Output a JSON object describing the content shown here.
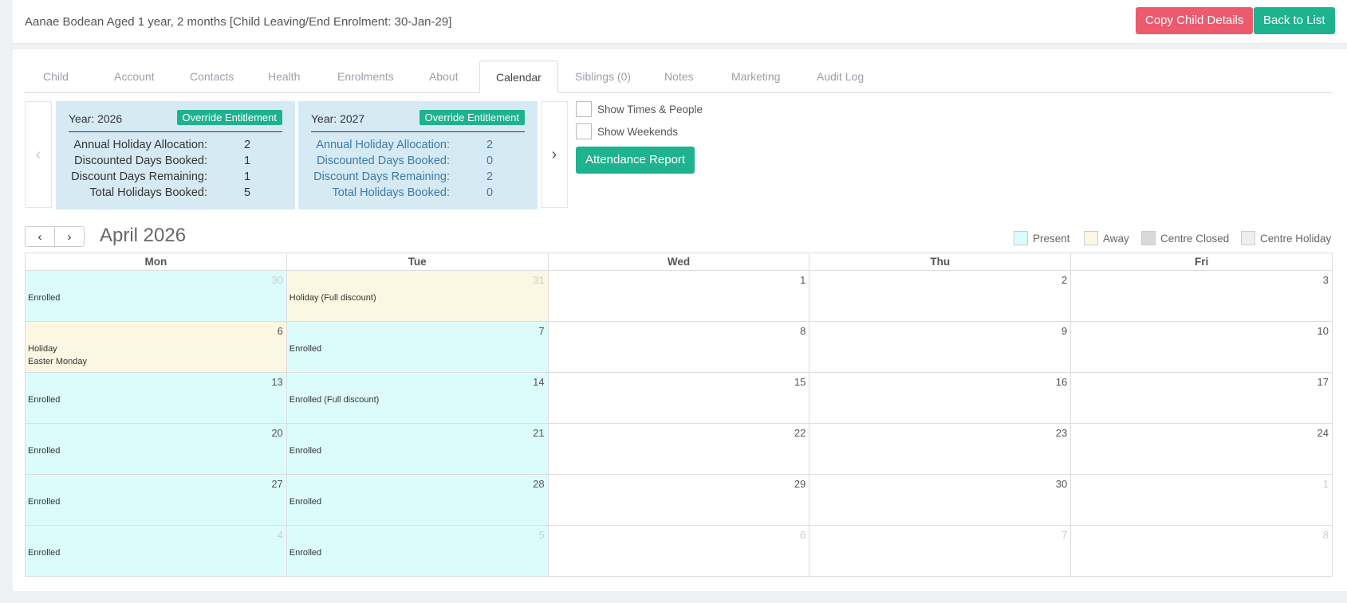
{
  "header": {
    "title": "Aanae Bodean Aged 1 year, 2 months [Child Leaving/End Enrolment: 30-Jan-29]",
    "copy_label": "Copy Child Details",
    "back_label": "Back to List"
  },
  "tabs": [
    {
      "label": "Child"
    },
    {
      "label": "Account"
    },
    {
      "label": "Contacts"
    },
    {
      "label": "Health"
    },
    {
      "label": "Enrolments"
    },
    {
      "label": "About"
    },
    {
      "label": "Calendar"
    },
    {
      "label": "Siblings (0)"
    },
    {
      "label": "Notes"
    },
    {
      "label": "Marketing"
    },
    {
      "label": "Audit Log"
    }
  ],
  "entitlements": [
    {
      "year_label": "Year: 2026",
      "override_label": "Override Entitlement",
      "stats": [
        {
          "label": "Annual Holiday Allocation:",
          "value": "2"
        },
        {
          "label": "Discounted Days Booked:",
          "value": "1"
        },
        {
          "label": "Discount Days Remaining:",
          "value": "1"
        },
        {
          "label": "Total Holidays Booked:",
          "value": "5"
        }
      ]
    },
    {
      "year_label": "Year: 2027",
      "override_label": "Override Entitlement",
      "stats": [
        {
          "label": "Annual Holiday Allocation:",
          "value": "2"
        },
        {
          "label": "Discounted Days Booked:",
          "value": "0"
        },
        {
          "label": "Discount Days Remaining:",
          "value": "2"
        },
        {
          "label": "Total Holidays Booked:",
          "value": "0"
        }
      ]
    }
  ],
  "options": {
    "show_times": "Show Times & People",
    "show_weekends": "Show Weekends",
    "attendance_report": "Attendance Report"
  },
  "calendar": {
    "title": "April 2026",
    "legend": [
      {
        "label": "Present",
        "color": "#dcfcfc"
      },
      {
        "label": "Away",
        "color": "#fcf7e3"
      },
      {
        "label": "Centre Closed",
        "color": "#d9d9d9"
      },
      {
        "label": "Centre Holiday",
        "color": "#eeeeee"
      }
    ],
    "days": [
      "Mon",
      "Tue",
      "Wed",
      "Thu",
      "Fri"
    ],
    "weeks": [
      [
        {
          "day": "30",
          "other": true,
          "status": "present",
          "events": [
            "Enrolled"
          ]
        },
        {
          "day": "31",
          "other": true,
          "status": "away",
          "events": [
            "Holiday (Full discount)"
          ]
        },
        {
          "day": "1",
          "events": []
        },
        {
          "day": "2",
          "events": []
        },
        {
          "day": "3",
          "events": []
        }
      ],
      [
        {
          "day": "6",
          "status": "away",
          "events": [
            "Holiday",
            "Easter Monday"
          ]
        },
        {
          "day": "7",
          "status": "present",
          "events": [
            "Enrolled"
          ]
        },
        {
          "day": "8",
          "events": []
        },
        {
          "day": "9",
          "events": []
        },
        {
          "day": "10",
          "events": []
        }
      ],
      [
        {
          "day": "13",
          "status": "present",
          "events": [
            "Enrolled"
          ]
        },
        {
          "day": "14",
          "status": "present",
          "events": [
            "Enrolled (Full discount)"
          ]
        },
        {
          "day": "15",
          "events": []
        },
        {
          "day": "16",
          "events": []
        },
        {
          "day": "17",
          "events": []
        }
      ],
      [
        {
          "day": "20",
          "status": "present",
          "events": [
            "Enrolled"
          ]
        },
        {
          "day": "21",
          "status": "present",
          "events": [
            "Enrolled"
          ]
        },
        {
          "day": "22",
          "events": []
        },
        {
          "day": "23",
          "events": []
        },
        {
          "day": "24",
          "events": []
        }
      ],
      [
        {
          "day": "27",
          "status": "present",
          "events": [
            "Enrolled"
          ]
        },
        {
          "day": "28",
          "status": "present",
          "events": [
            "Enrolled"
          ]
        },
        {
          "day": "29",
          "events": []
        },
        {
          "day": "30",
          "events": []
        },
        {
          "day": "1",
          "other": true,
          "events": []
        }
      ],
      [
        {
          "day": "4",
          "other": true,
          "status": "present",
          "events": [
            "Enrolled"
          ]
        },
        {
          "day": "5",
          "other": true,
          "status": "present",
          "events": [
            "Enrolled"
          ]
        },
        {
          "day": "6",
          "other": true,
          "events": []
        },
        {
          "day": "7",
          "other": true,
          "events": []
        },
        {
          "day": "8",
          "other": true,
          "events": []
        }
      ]
    ]
  }
}
